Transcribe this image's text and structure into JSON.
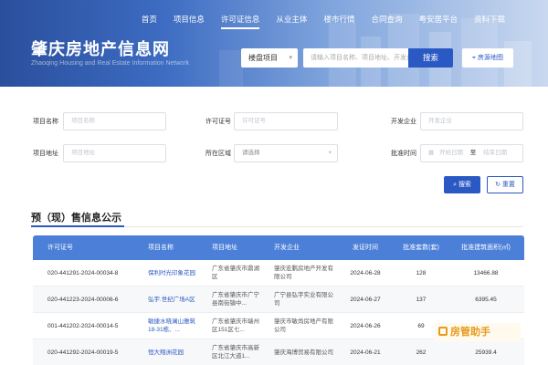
{
  "nav": {
    "items": [
      "首页",
      "项目信息",
      "许可证信息",
      "从业主体",
      "楼市行情",
      "合同查询",
      "粤安居平台",
      "资料下载"
    ],
    "active_index": 2
  },
  "header": {
    "title": "肇庆房地产信息网",
    "subtitle": "Zhaoqing Housing and Real Estate Information Network",
    "search_type": "楼盘项目",
    "search_placeholder": "请输入项目名称、项目地址、开发企业",
    "search_button": "搜索",
    "map_button": "房源地图"
  },
  "filters": {
    "project_name_label": "项目名称",
    "project_name_placeholder": "项目名称",
    "license_label": "许可证号",
    "license_placeholder": "许可证号",
    "developer_label": "开发企业",
    "developer_placeholder": "开发企业",
    "address_label": "项目地址",
    "address_placeholder": "项目地址",
    "region_label": "所在区域",
    "region_placeholder": "请选择",
    "date_label": "批准时间",
    "date_start_placeholder": "开始日期",
    "date_sep": "至",
    "date_end_placeholder": "结束日期",
    "search_button": "搜索",
    "reset_button": "重置"
  },
  "section": {
    "title": "预（现）售信息公示"
  },
  "table": {
    "headers": [
      "许可证号",
      "项目名称",
      "项目地址",
      "开发企业",
      "发证时间",
      "批准套数(套)",
      "批准建筑面积(㎡)"
    ],
    "rows": [
      [
        "020-441291-2024-00034-8",
        "保利时光印象花园",
        "广东省肇庆市鼎湖区",
        "肇庆宏鹏房地产开发有限公司",
        "2024-06-28",
        "128",
        "13466.88"
      ],
      [
        "020-441223-2024-00006-6",
        "弘宇.世纪广场A区",
        "广东省肇庆市广宁县南街镇中...",
        "广宁县弘宇实业有限公司",
        "2024-06-27",
        "137",
        "6395.45"
      ],
      [
        "001-441202-2024-00014-5",
        "敏捷水晓澜山雅筑18-31栋、...",
        "广东省肇庆市端州区151区七...",
        "肇庆市敏尚房地产有限公司",
        "2024-06-26",
        "69",
        ""
      ],
      [
        "020-441292-2024-00019-5",
        "恒大翔洲花园",
        "广东省肇庆市高新区北江大道1...",
        "肇庆海博贸易有限公司",
        "2024-06-21",
        "262",
        "25939.4"
      ]
    ]
  },
  "watermark": {
    "text": "房管助手"
  },
  "colors": {
    "primary": "#2b59c3",
    "table_header": "#4b7fd8",
    "watermark": "#e89a1d"
  }
}
